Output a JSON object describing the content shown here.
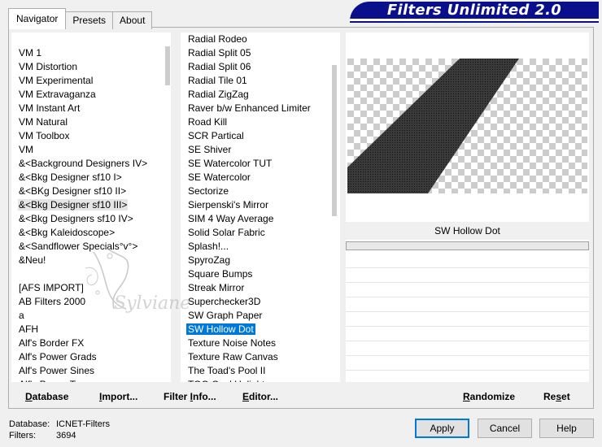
{
  "tabs": [
    {
      "label": "Navigator",
      "active": true
    },
    {
      "label": "Presets",
      "active": false
    },
    {
      "label": "About",
      "active": false
    }
  ],
  "banner_title": "Filters Unlimited 2.0",
  "categories": [
    "VM 1",
    "VM Distortion",
    "VM Experimental",
    "VM Extravaganza",
    "VM Instant Art",
    "VM Natural",
    "VM Toolbox",
    "VM",
    "&<Background Designers IV>",
    "&<Bkg Designer sf10 I>",
    "&<BKg Designer sf10 II>",
    "&<Bkg Designer sf10 III>",
    "&<Bkg Designers sf10 IV>",
    "&<Bkg Kaleidoscope>",
    "&<Sandflower Specials°v°>",
    "&Neu!",
    "",
    "[AFS IMPORT]",
    "AB Filters 2000",
    "a",
    "AFH",
    "Alf's Border FX",
    "Alf's Power Grads",
    "Alf's Power Sines",
    "Alf's Power Toys"
  ],
  "categories_hovered_index": 11,
  "filters": [
    "Radial Rodeo",
    "Radial Split 05",
    "Radial Split 06",
    "Radial Tile 01",
    "Radial ZigZag",
    "Raver b/w Enhanced Limiter",
    "Road Kill",
    "SCR  Partical",
    "SE Shiver",
    "SE Watercolor TUT",
    "SE Watercolor",
    "Sectorize",
    "Sierpenski's Mirror",
    "SIM 4 Way Average",
    "Solid Solar Fabric",
    "Splash!...",
    "SpyroZag",
    "Square Bumps",
    "Streak Mirror",
    "Superchecker3D",
    "SW Graph Paper",
    "SW Hollow Dot",
    "Texture Noise Notes",
    "Texture Raw Canvas",
    "The Toad's Pool II",
    "TOO Cool Uplight"
  ],
  "filters_selected_index": 21,
  "selected_filter_name": "SW Hollow Dot",
  "left_buttons": {
    "database": {
      "u": "D",
      "rest": "atabase"
    },
    "import": {
      "u": "I",
      "rest": "mport..."
    },
    "filter_info": {
      "pre": "Filter ",
      "u": "I",
      "rest": "nfo..."
    },
    "editor": {
      "u": "E",
      "rest": "ditor..."
    }
  },
  "right_buttons": {
    "randomize": {
      "u": "R",
      "rest": "andomize"
    },
    "reset": {
      "pre": "Re",
      "u": "s",
      "rest": "et"
    }
  },
  "status": {
    "database_label": "Database:",
    "database_value": "ICNET-Filters",
    "filters_label": "Filters:",
    "filters_value": "3694"
  },
  "dialog_buttons": {
    "apply": "Apply",
    "cancel": "Cancel",
    "help": "Help"
  },
  "watermark_text": "Sylviane",
  "colors": {
    "banner": "#0a0f8c",
    "selection": "#0078d7",
    "default_button_border": "#0078d7"
  }
}
